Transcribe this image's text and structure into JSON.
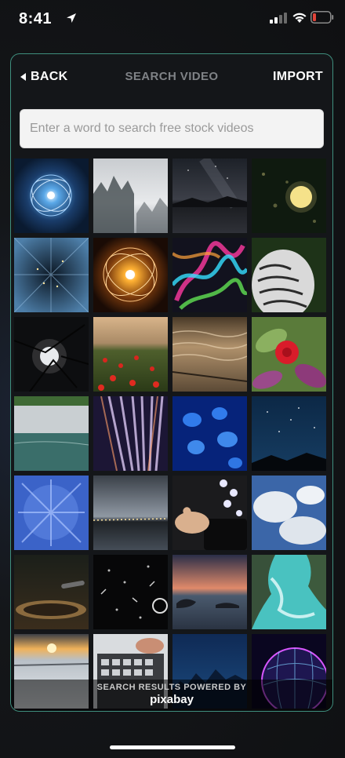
{
  "status_bar": {
    "time": "8:41",
    "icons": [
      "location-arrow-icon",
      "cellular-signal-icon",
      "wifi-icon",
      "battery-low-icon"
    ],
    "battery_color": "#e0443a"
  },
  "nav": {
    "back_label": "BACK",
    "title": "SEARCH VIDEO",
    "import_label": "IMPORT"
  },
  "search": {
    "placeholder": "Enter a word to search free stock videos",
    "value": ""
  },
  "thumbnails": [
    "glowing-orb-blue",
    "misty-forest",
    "milky-way-lake",
    "rain-window-moon",
    "light-streak-tunnel",
    "glowing-orb-orange",
    "colorful-smoke",
    "white-owl-feathers",
    "moon-through-branches",
    "poppy-field",
    "ocean-waves-sunset",
    "red-flower-closeup",
    "cliff-lake",
    "light-rays-purple",
    "blue-jellyfish",
    "starry-night-hills",
    "frosted-forest-aerial",
    "coastline-dusk",
    "smartphone-social-icons",
    "clouds-earth-from-space",
    "record-player",
    "floating-letters",
    "island-sunset",
    "turquoise-waves-aerial",
    "snowy-sunset",
    "laptop-typing",
    "night-city-skyline",
    "earth-neon-grid"
  ],
  "footer": {
    "powered_by": "SEARCH RESULTS POWERED BY",
    "brand": "pixabay"
  },
  "colors": {
    "panel_border": "#3f8f7e",
    "nav_title": "#7f8286",
    "background": "#141619"
  }
}
